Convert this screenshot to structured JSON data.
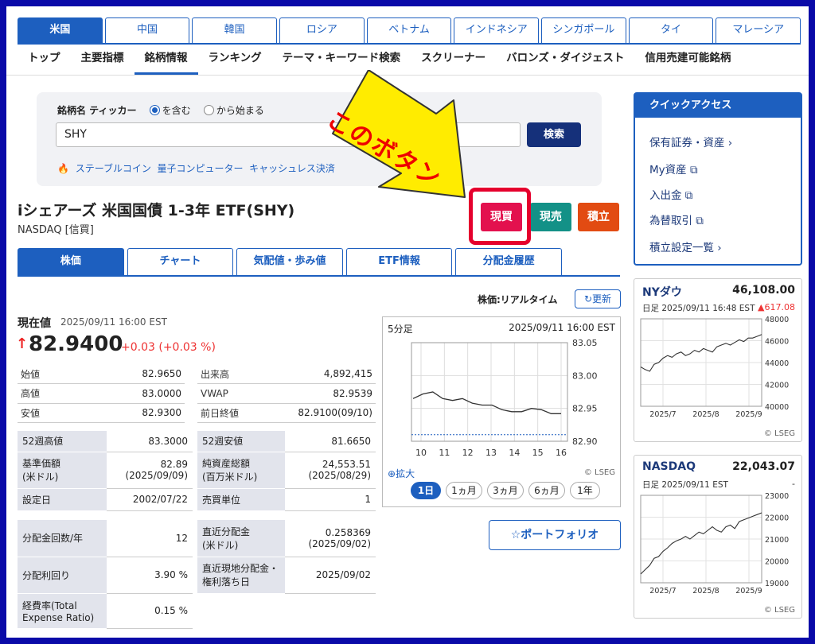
{
  "country_tabs": [
    "米国",
    "中国",
    "韓国",
    "ロシア",
    "ベトナム",
    "インドネシア",
    "シンガポール",
    "タイ",
    "マレーシア"
  ],
  "subnav": [
    "トップ",
    "主要指標",
    "銘柄情報",
    "ランキング",
    "テーマ・キーワード検索",
    "スクリーナー",
    "バロンズ・ダイジェスト",
    "信用売建可能銘柄"
  ],
  "search": {
    "label": "銘柄名 ティッカー",
    "opt_contains": "を含む",
    "opt_starts": "から始まる",
    "value": "SHY",
    "button": "検索",
    "trends": [
      "ステーブルコイン",
      "量子コンピューター",
      "キャッシュレス決済"
    ]
  },
  "callout": "このボタン",
  "stock": {
    "title": "iシェアーズ 米国国債 1-3年 ETF(SHY)",
    "exchange": "NASDAQ [信買]"
  },
  "actions": {
    "buy": "現買",
    "sell": "現売",
    "accumulate": "積立"
  },
  "stock_tabs": [
    "株価",
    "チャート",
    "気配値・歩み値",
    "ETF情報",
    "分配金履歴"
  ],
  "realtime_label": "株価:リアルタイム",
  "refresh": "更新",
  "current": {
    "label": "現在値",
    "time": "2025/09/11 16:00 EST",
    "arrow": "↑",
    "price": "82.9400",
    "change": "+0.03 (+0.03 %)"
  },
  "quotes_left": [
    [
      "始値",
      "82.9650"
    ],
    [
      "高値",
      "83.0000"
    ],
    [
      "安値",
      "82.9300"
    ]
  ],
  "quotes_right": [
    [
      "出来高",
      "4,892,415"
    ],
    [
      "VWAP",
      "82.9539"
    ],
    [
      "前日終値",
      "82.9100(09/10)"
    ]
  ],
  "info_rows": [
    {
      "k1": "52週高値",
      "v1": "83.3000",
      "k2": "52週安値",
      "v2": "81.6650"
    },
    {
      "k1": "基準価額\n(米ドル)",
      "v1": "82.89\n(2025/09/09)",
      "k2": "純資産総額\n(百万米ドル)",
      "v2": "24,553.51\n(2025/08/29)"
    },
    {
      "k1": "設定日",
      "v1": "2002/07/22",
      "k2": "売買単位",
      "v2": "1"
    }
  ],
  "div_rows": [
    {
      "k1": "分配金回数/年",
      "v1": "12",
      "k2": "直近分配金\n(米ドル)",
      "v2": "0.258369\n(2025/09/02)"
    },
    {
      "k1": "分配利回り",
      "v1": "3.90 %",
      "k2": "直近現地分配金・\n権利落ち日",
      "v2": "2025/09/02"
    },
    {
      "k1": "経費率(Total\nExpense Ratio)",
      "v1": "0.15 %",
      "k2": "",
      "v2": ""
    }
  ],
  "chart": {
    "interval": "5分足",
    "time": "2025/09/11 16:00 EST",
    "expand": "拡大",
    "lseg": "© LSEG",
    "ranges": [
      "1日",
      "1ヵ月",
      "3ヵ月",
      "6ヵ月",
      "1年"
    ],
    "y_ticks": [
      "83.05",
      "83.00",
      "82.95",
      "82.90"
    ],
    "x_ticks": [
      "10",
      "11",
      "12",
      "13",
      "14",
      "15",
      "16"
    ]
  },
  "portfolio_btn": "ポートフォリオ",
  "quick_access": {
    "title": "クイックアクセス",
    "items": [
      "保有証券・資産 ›",
      "My資産",
      "入出金",
      "為替取引",
      "積立設定一覧 ›"
    ]
  },
  "indices": [
    {
      "name": "NYダウ",
      "value": "46,108.00",
      "time": "日足 2025/09/11 16:48 EST",
      "change": "▲617.08",
      "y_ticks": [
        "48000",
        "46000",
        "44000",
        "42000",
        "40000"
      ],
      "x_ticks": [
        "2025/7",
        "2025/8",
        "2025/9"
      ],
      "lseg": "© LSEG"
    },
    {
      "name": "NASDAQ",
      "value": "22,043.07",
      "time": "日足 2025/09/11 EST",
      "change": "-",
      "y_ticks": [
        "23000",
        "22000",
        "21000",
        "20000",
        "19000"
      ],
      "x_ticks": [
        "2025/7",
        "2025/8",
        "2025/9"
      ],
      "lseg": "© LSEG"
    }
  ],
  "chart_data": {
    "type": "line",
    "title": "",
    "xlabel": "",
    "ylabel": "",
    "x": [
      "10",
      "11",
      "12",
      "13",
      "14",
      "15",
      "16"
    ],
    "series": [
      {
        "values": [
          82.965,
          82.972,
          82.975,
          82.965,
          82.962,
          82.965,
          82.958,
          82.955,
          82.955,
          82.948,
          82.945,
          82.945,
          82.95,
          82.948,
          82.942,
          82.942
        ]
      }
    ],
    "ylim": [
      82.9,
      83.05
    ],
    "reference_line": 82.91
  }
}
